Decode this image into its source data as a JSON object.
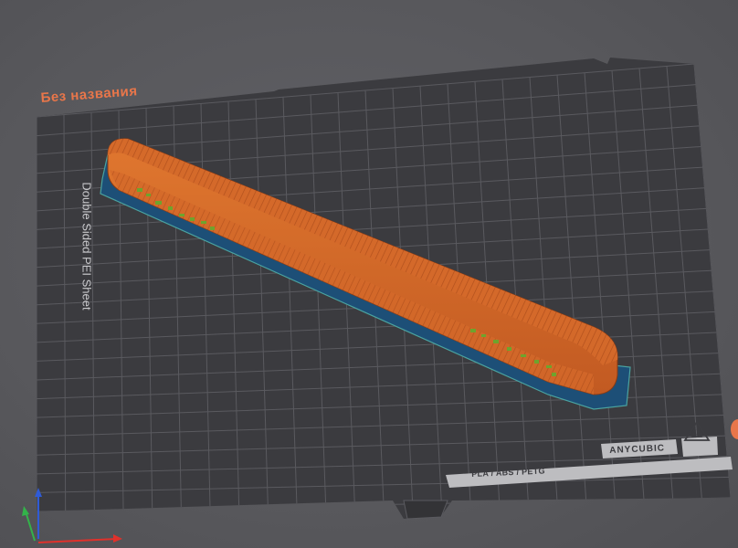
{
  "plate": {
    "title": "Без названия",
    "sheet_label": "Double Sided PEI Sheet",
    "material_label": "PLA / ABS / PETG",
    "brand_label": "ANYCUBIC"
  },
  "icons": {
    "heated_bed": "heated-bed-warning-icon",
    "axes": "xyz-axes-icon"
  },
  "colors": {
    "background": "#58585c",
    "plate": "#3b3b3f",
    "grid": "#55555a",
    "model_orange": "#d66a2c",
    "model_shadow": "#1c4f78",
    "infill_green": "#6fa32d",
    "title_accent": "#e8764a",
    "axis_x": "#e0312b",
    "axis_y": "#33b34a",
    "axis_z": "#2f5bd6"
  }
}
